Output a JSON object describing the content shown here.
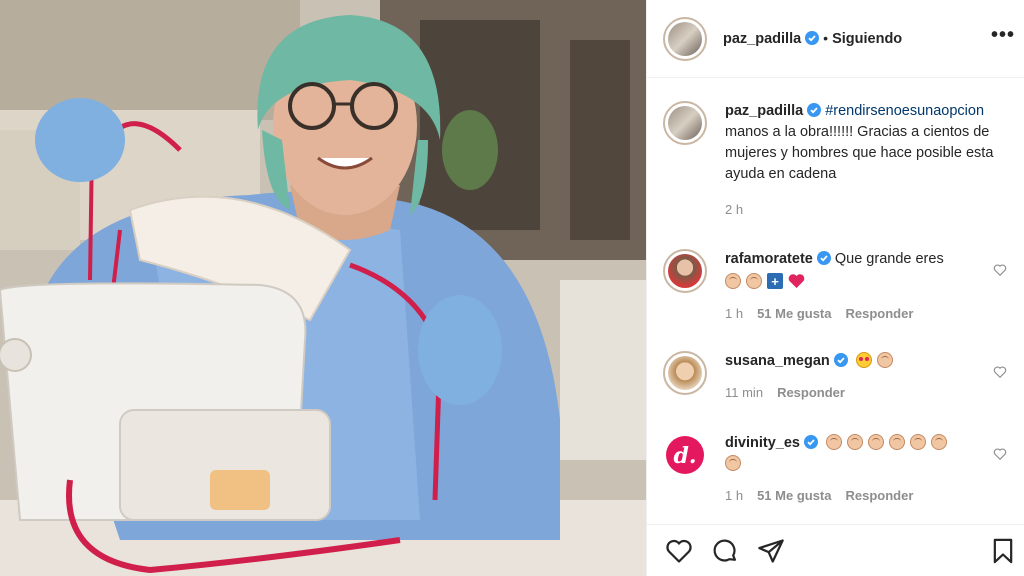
{
  "post": {
    "author": "paz_padilla",
    "follow_separator": "•",
    "follow_status": "Siguiendo",
    "more_label": "•••",
    "caption_hashtag": "#rendirsenoesunaopcion",
    "caption_text": "manos a la obra!!!!!! Gracias a cientos de mujeres y hombres que hace posible esta ayuda en cadena",
    "time": "2 h"
  },
  "comments": [
    {
      "user": "rafamoratete",
      "text": "Que grande eres",
      "emojis": [
        "hand",
        "hand",
        "plus",
        "heart"
      ],
      "time": "1 h",
      "likes": "51 Me gusta",
      "reply": "Responder"
    },
    {
      "user": "susana_megan",
      "text": "",
      "emojis": [
        "eyes",
        "hand"
      ],
      "time": "11 min",
      "likes": "",
      "reply": "Responder"
    },
    {
      "user": "divinity_es",
      "text": "",
      "emojis": [
        "hand",
        "hand",
        "hand",
        "hand",
        "hand",
        "hand",
        "hand"
      ],
      "time": "1 h",
      "likes": "51 Me gusta",
      "reply": "Responder"
    }
  ],
  "icons": {
    "verified": "verified-badge-icon",
    "like": "heart-icon",
    "comment": "comment-bubble-icon",
    "share": "paper-plane-icon",
    "save": "bookmark-icon"
  },
  "colors": {
    "verified": "#3897f0",
    "link": "#00376b",
    "meta": "#8e8e8e",
    "heart_red": "#e0245e",
    "divinity": "#e4185f"
  }
}
